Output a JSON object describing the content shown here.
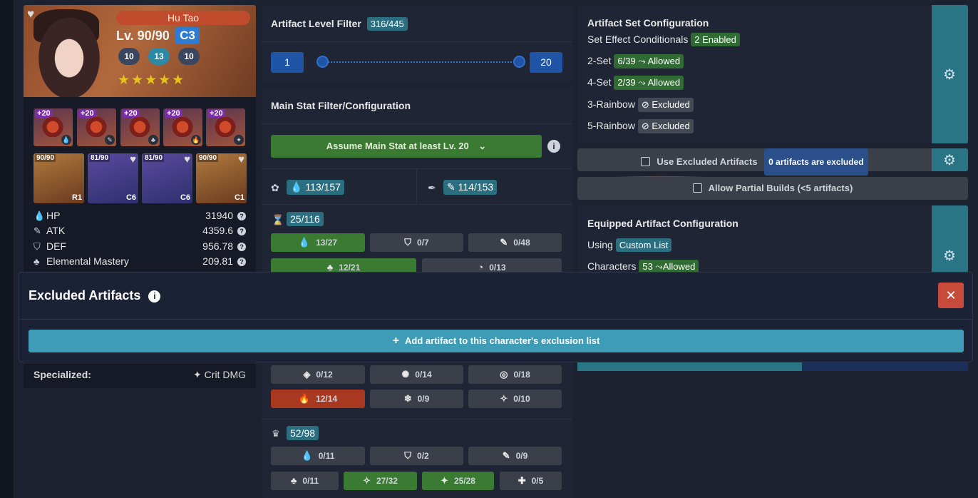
{
  "character": {
    "name": "Hu Tao",
    "level": "Lv. 90/90",
    "constellation": "C3",
    "talents": [
      "10",
      "13",
      "10"
    ],
    "stars": "★★★★★",
    "artifacts": [
      {
        "level": "+20",
        "mark": "💧"
      },
      {
        "level": "+20",
        "mark": "✎"
      },
      {
        "level": "+20",
        "mark": "♣"
      },
      {
        "level": "+20",
        "mark": "🔥"
      },
      {
        "level": "+20",
        "mark": "✦"
      }
    ],
    "team": [
      {
        "level": "90/90",
        "tag": "R1"
      },
      {
        "level": "81/90",
        "tag": "C6"
      },
      {
        "level": "81/90",
        "tag": "C6"
      },
      {
        "level": "90/90",
        "tag": "C1"
      }
    ],
    "stats": [
      {
        "label": "HP",
        "value": "31940",
        "icon": "hp-icon"
      },
      {
        "label": "ATK",
        "value": "4359.6",
        "icon": "atk-icon"
      },
      {
        "label": "DEF",
        "value": "956.78",
        "icon": "def-icon"
      },
      {
        "label": "Elemental Mastery",
        "value": "209.81",
        "icon": "em-icon"
      }
    ],
    "specialized_label": "Specialized:",
    "specialized_value": "Crit DMG"
  },
  "level_filter": {
    "title": "Artifact Level Filter",
    "count": "316/445",
    "min": "1",
    "max": "20"
  },
  "main_stat": {
    "title": "Main Stat Filter/Configuration",
    "assume_label": "Assume Main Stat at least Lv. 20",
    "flower": "113/157",
    "plume": "114/153",
    "sands_count": "25/116",
    "sands_buttons": [
      "13/27",
      "0/7",
      "0/48"
    ],
    "sands_row2": [
      "12/21",
      "0/13"
    ],
    "goblet_buttons_row1": [
      "0/12",
      "0/14",
      "0/18"
    ],
    "goblet_buttons_row2": [
      "12/14",
      "0/9",
      "0/10"
    ],
    "circlet_count": "52/98",
    "circlet_row1": [
      "0/11",
      "0/2",
      "0/9"
    ],
    "circlet_row2": [
      "0/11",
      "27/32",
      "25/28",
      "0/5"
    ]
  },
  "set_config": {
    "title": "Artifact Set Configuration",
    "conditionals_label": "Set Effect Conditionals",
    "conditionals_value": "2 Enabled",
    "two_set_label": "2-Set",
    "two_set_value": "6/39 ⤳ Allowed",
    "four_set_label": "4-Set",
    "four_set_value": "2/39 ⤳ Allowed",
    "three_rainbow_label": "3-Rainbow",
    "three_rainbow_value": "⊘ Excluded",
    "five_rainbow_label": "5-Rainbow",
    "five_rainbow_value": "⊘ Excluded"
  },
  "excluded": {
    "use_label": "Use Excluded Artifacts",
    "count_badge": "0 artifacts are excluded",
    "partial_label": "Allow Partial Builds (<5 artifacts)"
  },
  "equipped": {
    "title": "Equipped Artifact Configuration",
    "using_label": "Using",
    "using_value": "Custom List",
    "characters_label": "Characters",
    "characters_value": "53 ⤳Allowed"
  },
  "modal": {
    "title": "Excluded Artifacts",
    "close_glyph": "✕",
    "add_label": "Add artifact to this character's exclusion list"
  },
  "colors": {
    "accent_teal": "#2a7585",
    "green": "#3a7a32",
    "red": "#a83820",
    "close_red": "#c84a3b"
  }
}
